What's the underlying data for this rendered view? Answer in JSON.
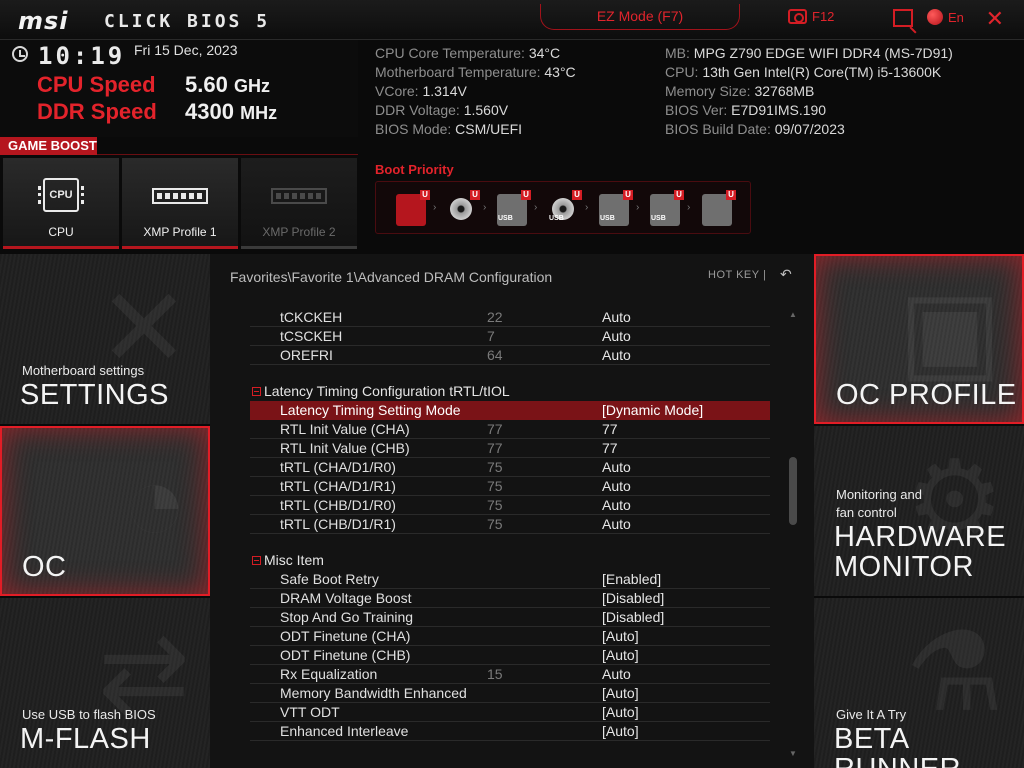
{
  "header": {
    "logo": "msi",
    "bios_name": "CLICK BIOS 5",
    "ez_mode": "EZ Mode (F7)",
    "screenshot_key": "F12",
    "language": "En",
    "icons": [
      "camera-icon",
      "search-icon",
      "globe-icon",
      "close-icon"
    ],
    "accent_color": "#e3232b"
  },
  "status": {
    "time": "10:19",
    "date": "Fri  15 Dec, 2023",
    "cpu_speed_label": "CPU Speed",
    "cpu_speed_value": "5.60",
    "cpu_speed_unit": "GHz",
    "ddr_speed_label": "DDR Speed",
    "ddr_speed_value": "4300",
    "ddr_speed_unit": "MHz"
  },
  "sysinfo_left": [
    {
      "k": "CPU Core Temperature: ",
      "v": "34°C"
    },
    {
      "k": "Motherboard Temperature: ",
      "v": "43°C"
    },
    {
      "k": "VCore: ",
      "v": "1.314V"
    },
    {
      "k": "DDR Voltage: ",
      "v": "1.560V"
    },
    {
      "k": "BIOS Mode: ",
      "v": "CSM/UEFI"
    }
  ],
  "sysinfo_right": [
    {
      "k": "MB: ",
      "v": "MPG Z790 EDGE WIFI DDR4 (MS-7D91)"
    },
    {
      "k": "CPU: ",
      "v": "13th Gen Intel(R) Core(TM) i5-13600K"
    },
    {
      "k": "Memory Size: ",
      "v": "32768MB"
    },
    {
      "k": "BIOS Ver: ",
      "v": "E7D91IMS.190"
    },
    {
      "k": "BIOS Build Date: ",
      "v": "09/07/2023"
    }
  ],
  "game_boost": {
    "title": "GAME BOOST",
    "tiles": [
      {
        "label": "CPU",
        "icon_text": "CPU",
        "enabled": true
      },
      {
        "label": "XMP Profile 1",
        "enabled": true
      },
      {
        "label": "XMP Profile 2",
        "enabled": false
      }
    ]
  },
  "boot": {
    "title": "Boot Priority",
    "badge": "U",
    "devices": [
      {
        "icon": "hdd-icon",
        "tag": ""
      },
      {
        "icon": "optical-disc-icon",
        "tag": ""
      },
      {
        "icon": "usb-drive-icon",
        "tag": "USB"
      },
      {
        "icon": "usb-optical-icon",
        "tag": "USB"
      },
      {
        "icon": "usb-hdd-icon",
        "tag": "USB"
      },
      {
        "icon": "usb-floppy-icon",
        "tag": "USB"
      },
      {
        "icon": "network-icon",
        "tag": ""
      }
    ]
  },
  "left_tiles": {
    "settings": {
      "sub": "Motherboard settings",
      "big": "SETTINGS"
    },
    "oc": {
      "big": "OC"
    },
    "mflash": {
      "sub": "Use USB to flash BIOS",
      "big": "M-FLASH"
    }
  },
  "right_tiles": {
    "oc_profile": {
      "big": "OC PROFILE"
    },
    "hw_monitor": {
      "sub1": "Monitoring and",
      "sub2": "fan control",
      "big1": "HARDWARE",
      "big2": "MONITOR"
    },
    "beta_runner": {
      "sub": "Give It A Try",
      "big": "BETA RUNNER"
    }
  },
  "panel": {
    "breadcrumb": "Favorites\\Favorite 1\\Advanced DRAM Configuration",
    "hotkey": "HOT KEY  |",
    "group1": [
      {
        "name": "tCKCKEH",
        "def": "22",
        "val": "Auto"
      },
      {
        "name": "tCSCKEH",
        "def": "7",
        "val": "Auto"
      },
      {
        "name": "OREFRI",
        "def": "64",
        "val": "Auto"
      }
    ],
    "section2_title": "Latency Timing Configuration tRTL/tIOL",
    "group2": [
      {
        "name": "Latency Timing Setting Mode",
        "def": "",
        "val": "[Dynamic Mode]"
      },
      {
        "name": "RTL Init Value (CHA)",
        "def": "77",
        "val": "77"
      },
      {
        "name": "RTL Init Value (CHB)",
        "def": "77",
        "val": "77"
      },
      {
        "name": "tRTL (CHA/D1/R0)",
        "def": "75",
        "val": "Auto"
      },
      {
        "name": "tRTL (CHA/D1/R1)",
        "def": "75",
        "val": "Auto"
      },
      {
        "name": "tRTL (CHB/D1/R0)",
        "def": "75",
        "val": "Auto"
      },
      {
        "name": "tRTL (CHB/D1/R1)",
        "def": "75",
        "val": "Auto"
      }
    ],
    "section3_title": "Misc Item",
    "group3": [
      {
        "name": "Safe Boot Retry",
        "def": "",
        "val": "[Enabled]"
      },
      {
        "name": "DRAM Voltage Boost",
        "def": "",
        "val": "[Disabled]"
      },
      {
        "name": "Stop And Go Training",
        "def": "",
        "val": "[Disabled]"
      },
      {
        "name": "ODT Finetune (CHA)",
        "def": "",
        "val": "[Auto]"
      },
      {
        "name": "ODT Finetune (CHB)",
        "def": "",
        "val": "[Auto]"
      },
      {
        "name": "Rx Equalization",
        "def": "15",
        "val": "Auto"
      },
      {
        "name": "Memory Bandwidth Enhanced",
        "def": "",
        "val": "[Auto]"
      },
      {
        "name": "VTT ODT",
        "def": "",
        "val": "[Auto]"
      },
      {
        "name": "Enhanced Interleave",
        "def": "",
        "val": "[Auto]"
      }
    ],
    "scroll_position": 0.38
  }
}
